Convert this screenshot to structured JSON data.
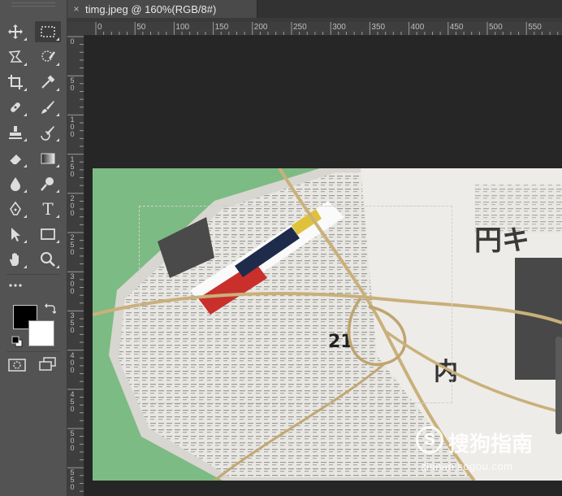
{
  "document": {
    "tab_title": "timg.jpeg @ 160%(RGB/8#)",
    "close_glyph": "×"
  },
  "toolbar": {
    "tools": [
      {
        "name": "move-tool-icon"
      },
      {
        "name": "rectangular-marquee-tool-icon",
        "active": true
      },
      {
        "name": "lasso-tool-icon"
      },
      {
        "name": "quick-selection-tool-icon"
      },
      {
        "name": "crop-tool-icon"
      },
      {
        "name": "eyedropper-tool-icon"
      },
      {
        "name": "healing-brush-tool-icon"
      },
      {
        "name": "brush-tool-icon"
      },
      {
        "name": "clone-stamp-tool-icon"
      },
      {
        "name": "history-brush-tool-icon"
      },
      {
        "name": "eraser-tool-icon"
      },
      {
        "name": "gradient-tool-icon"
      },
      {
        "name": "blur-tool-icon"
      },
      {
        "name": "dodge-tool-icon"
      },
      {
        "name": "pen-tool-icon"
      },
      {
        "name": "type-tool-icon",
        "glyph": "T"
      },
      {
        "name": "path-selection-tool-icon"
      },
      {
        "name": "rectangle-tool-icon"
      },
      {
        "name": "hand-tool-icon"
      },
      {
        "name": "zoom-tool-icon"
      },
      {
        "name": "more-tools-icon"
      }
    ],
    "foreground_color": "#000000",
    "background_color": "#ffffff"
  },
  "rulers": {
    "horizontal_labels": [
      "0",
      "50",
      "100",
      "150",
      "200",
      "250",
      "300",
      "350",
      "400",
      "450",
      "500",
      "550"
    ],
    "vertical_labels": [
      [
        "0"
      ],
      [
        "5",
        "0"
      ],
      [
        "1",
        "0",
        "0"
      ],
      [
        "1",
        "5",
        "0"
      ],
      [
        "2",
        "0",
        "0"
      ],
      [
        "2",
        "5",
        "0"
      ],
      [
        "3",
        "0",
        "0"
      ],
      [
        "3",
        "5",
        "0"
      ],
      [
        "4",
        "0",
        "0"
      ],
      [
        "4",
        "5",
        "0"
      ],
      [
        "5",
        "0",
        "0"
      ],
      [
        "5",
        "5",
        "0"
      ]
    ]
  },
  "watermark": {
    "logo_glyph": "S",
    "text": "搜狗指南",
    "url": "zhinan.sogou.com"
  },
  "colors": {
    "canvas_green": "#7dbb84",
    "workspace": "#262626",
    "toolbar": "#535353"
  }
}
